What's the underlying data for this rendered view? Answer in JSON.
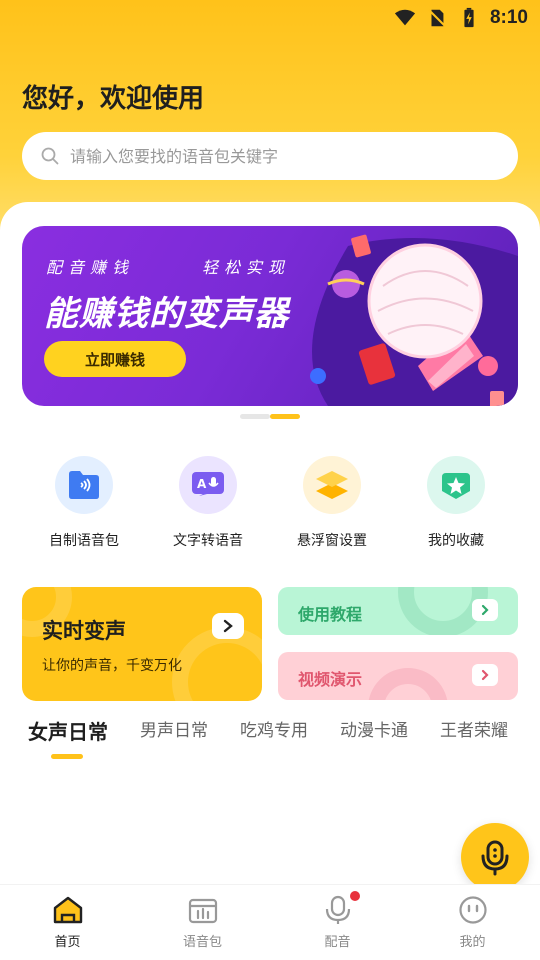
{
  "status": {
    "time": "8:10"
  },
  "header": {
    "greeting": "您好，欢迎使用"
  },
  "search": {
    "placeholder": "请输入您要找的语音包关键字"
  },
  "banner": {
    "slogan_left": "配音赚钱",
    "slogan_right": "轻松实现",
    "headline": "能赚钱的变声器",
    "cta": "立即赚钱"
  },
  "quick_actions": [
    {
      "label": "自制语音包",
      "icon": "folder-voice-icon"
    },
    {
      "label": "文字转语音",
      "icon": "text-to-speech-icon"
    },
    {
      "label": "悬浮窗设置",
      "icon": "layers-icon"
    },
    {
      "label": "我的收藏",
      "icon": "star-icon"
    }
  ],
  "cards": {
    "realtime_title": "实时变声",
    "realtime_sub": "让你的声音，千变万化",
    "tutorial": "使用教程",
    "demo": "视频演示"
  },
  "tabs": [
    "女声日常",
    "男声日常",
    "吃鸡专用",
    "动漫卡通",
    "王者荣耀"
  ],
  "active_tab": "女声日常",
  "bottom_nav": [
    {
      "label": "首页",
      "icon": "home-icon",
      "active": true
    },
    {
      "label": "语音包",
      "icon": "voice-pack-icon",
      "active": false
    },
    {
      "label": "配音",
      "icon": "dubbing-mic-icon",
      "active": false
    },
    {
      "label": "我的",
      "icon": "profile-icon",
      "active": false
    }
  ],
  "colors": {
    "accent": "#ffc21a",
    "banner": "#7a2bd6",
    "green": "#2ea86b",
    "pink": "#e0566e"
  }
}
